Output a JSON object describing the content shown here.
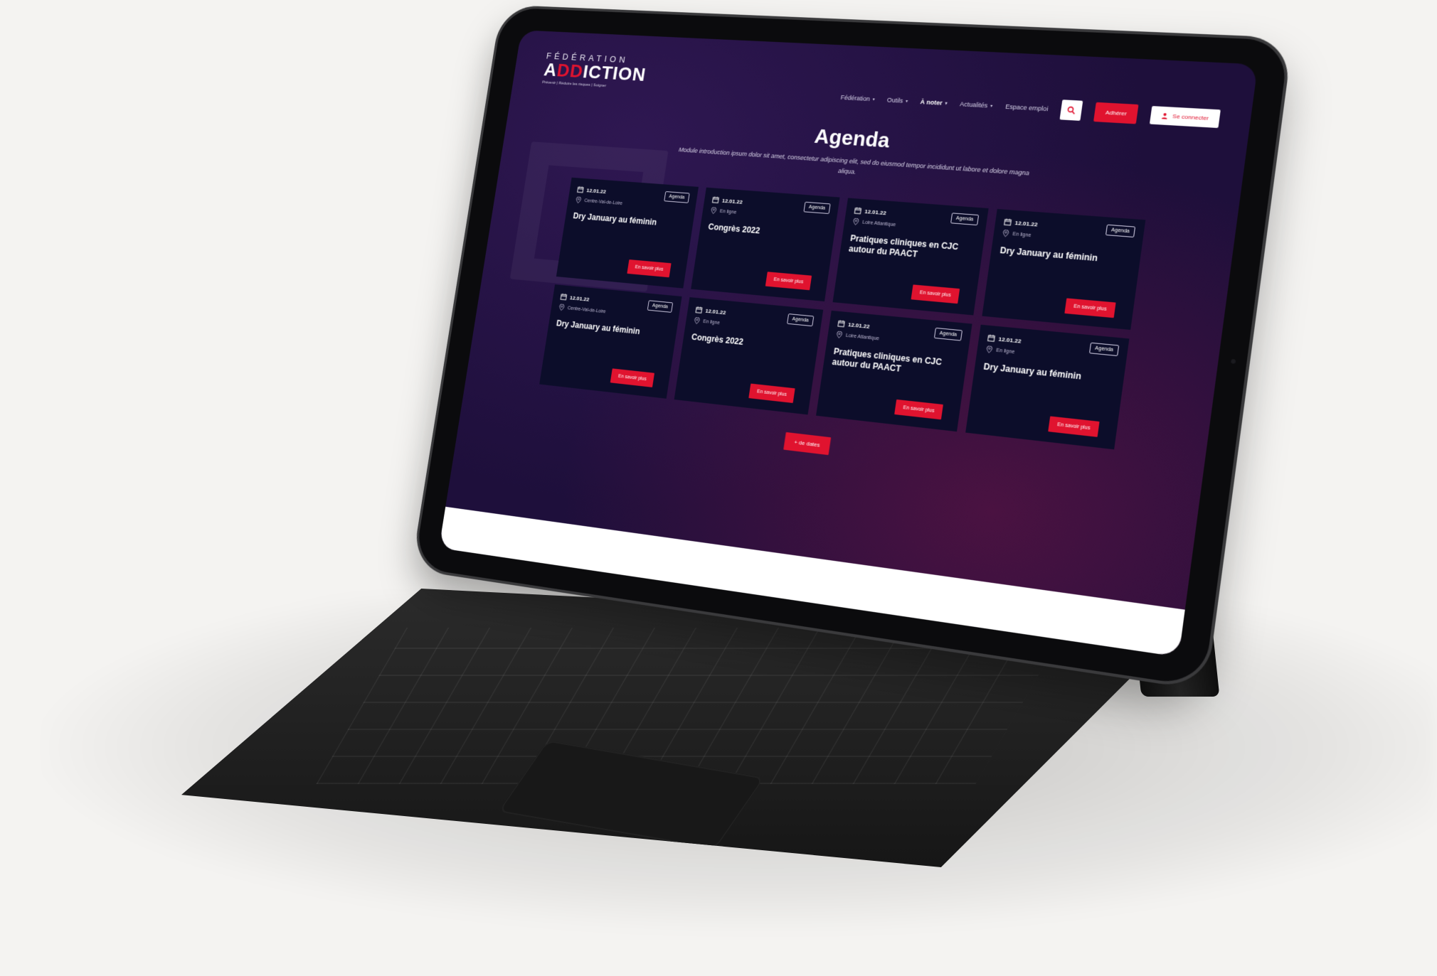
{
  "colors": {
    "accent": "#e0132f",
    "screen_bg": "#1e0f3b",
    "card_bg": "#0c0d2a"
  },
  "logo": {
    "top": "FÉDÉRATION",
    "main_prefix": "A",
    "main_mark": "DD",
    "main_suffix": "ICTION",
    "tagline": "Prévenir | Réduire les risques | Soigner"
  },
  "nav": {
    "items": [
      {
        "label": "Fédération",
        "caret": "▾"
      },
      {
        "label": "Outils",
        "caret": "▾"
      },
      {
        "label": "À noter",
        "caret": "▾"
      },
      {
        "label": "Actualités",
        "caret": "▾"
      },
      {
        "label": "Espace emploi",
        "caret": ""
      }
    ],
    "search_icon": "search-icon",
    "adherer_label": "Adhérer",
    "login_label": "Se connecter"
  },
  "hero": {
    "title": "Agenda",
    "intro": "Module introduction ipsum dolor sit amet, consectetur adipiscing elit, sed do eiusmod tempor incididunt ut labore et dolore magna aliqua."
  },
  "cards": [
    {
      "date": "12.01.22",
      "tag": "Agenda",
      "location": "Centre-Val-de-Loire",
      "title": "Dry January au féminin",
      "cta": "En savoir plus"
    },
    {
      "date": "12.01.22",
      "tag": "Agenda",
      "location": "En ligne",
      "title": "Congrès 2022",
      "cta": "En savoir plus"
    },
    {
      "date": "12.01.22",
      "tag": "Agenda",
      "location": "Loire Atlantique",
      "title": "Pratiques cliniques en CJC autour du PAACT",
      "cta": "En savoir plus"
    },
    {
      "date": "12.01.22",
      "tag": "Agenda",
      "location": "En ligne",
      "title": "Dry January au féminin",
      "cta": "En savoir plus"
    },
    {
      "date": "12.01.22",
      "tag": "Agenda",
      "location": "Centre-Val-de-Loire",
      "title": "Dry January au féminin",
      "cta": "En savoir plus"
    },
    {
      "date": "12.01.22",
      "tag": "Agenda",
      "location": "En ligne",
      "title": "Congrès 2022",
      "cta": "En savoir plus"
    },
    {
      "date": "12.01.22",
      "tag": "Agenda",
      "location": "Loire Atlantique",
      "title": "Pratiques cliniques en CJC autour du PAACT",
      "cta": "En savoir plus"
    },
    {
      "date": "12.01.22",
      "tag": "Agenda",
      "location": "En ligne",
      "title": "Dry January au féminin",
      "cta": "En savoir plus"
    }
  ],
  "more_label": "+ de dates"
}
